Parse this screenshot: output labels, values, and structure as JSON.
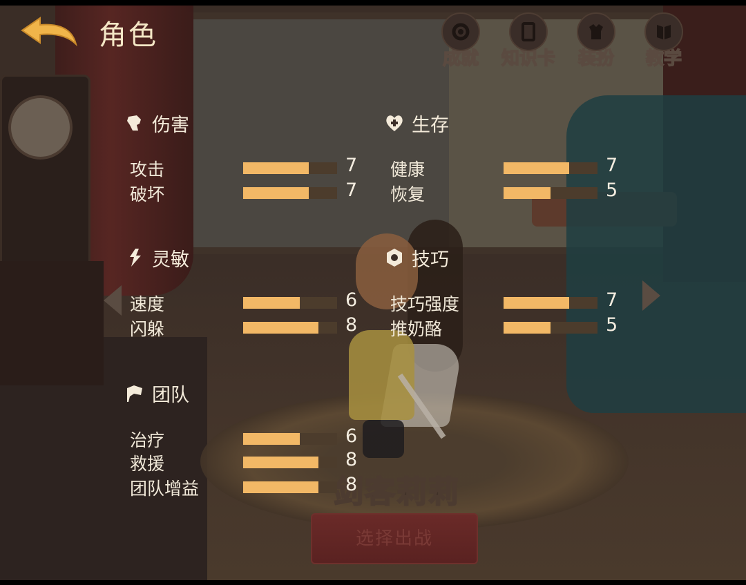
{
  "header": {
    "title": "角色"
  },
  "nav": [
    {
      "label": "成就",
      "icon": "gear-badge-icon"
    },
    {
      "label": "知识卡",
      "icon": "card-icon"
    },
    {
      "label": "装扮",
      "icon": "outfit-icon"
    },
    {
      "label": "教学",
      "icon": "book-icon"
    }
  ],
  "character": {
    "name": "剑客莉莉"
  },
  "select_button": "选择出战",
  "max_stat": 10,
  "sections": {
    "damage": {
      "title": "伤害",
      "stats": [
        {
          "label": "攻击",
          "value": 7
        },
        {
          "label": "破坏",
          "value": 7
        }
      ]
    },
    "survival": {
      "title": "生存",
      "stats": [
        {
          "label": "健康",
          "value": 7
        },
        {
          "label": "恢复",
          "value": 5
        }
      ]
    },
    "agility": {
      "title": "灵敏",
      "stats": [
        {
          "label": "速度",
          "value": 6
        },
        {
          "label": "闪躲",
          "value": 8
        }
      ]
    },
    "skill": {
      "title": "技巧",
      "stats": [
        {
          "label": "技巧强度",
          "value": 7
        },
        {
          "label": "推奶酪",
          "value": 5
        }
      ]
    },
    "team": {
      "title": "团队",
      "stats": [
        {
          "label": "治疗",
          "value": 6
        },
        {
          "label": "救援",
          "value": 8
        },
        {
          "label": "团队增益",
          "value": 8
        }
      ]
    }
  }
}
